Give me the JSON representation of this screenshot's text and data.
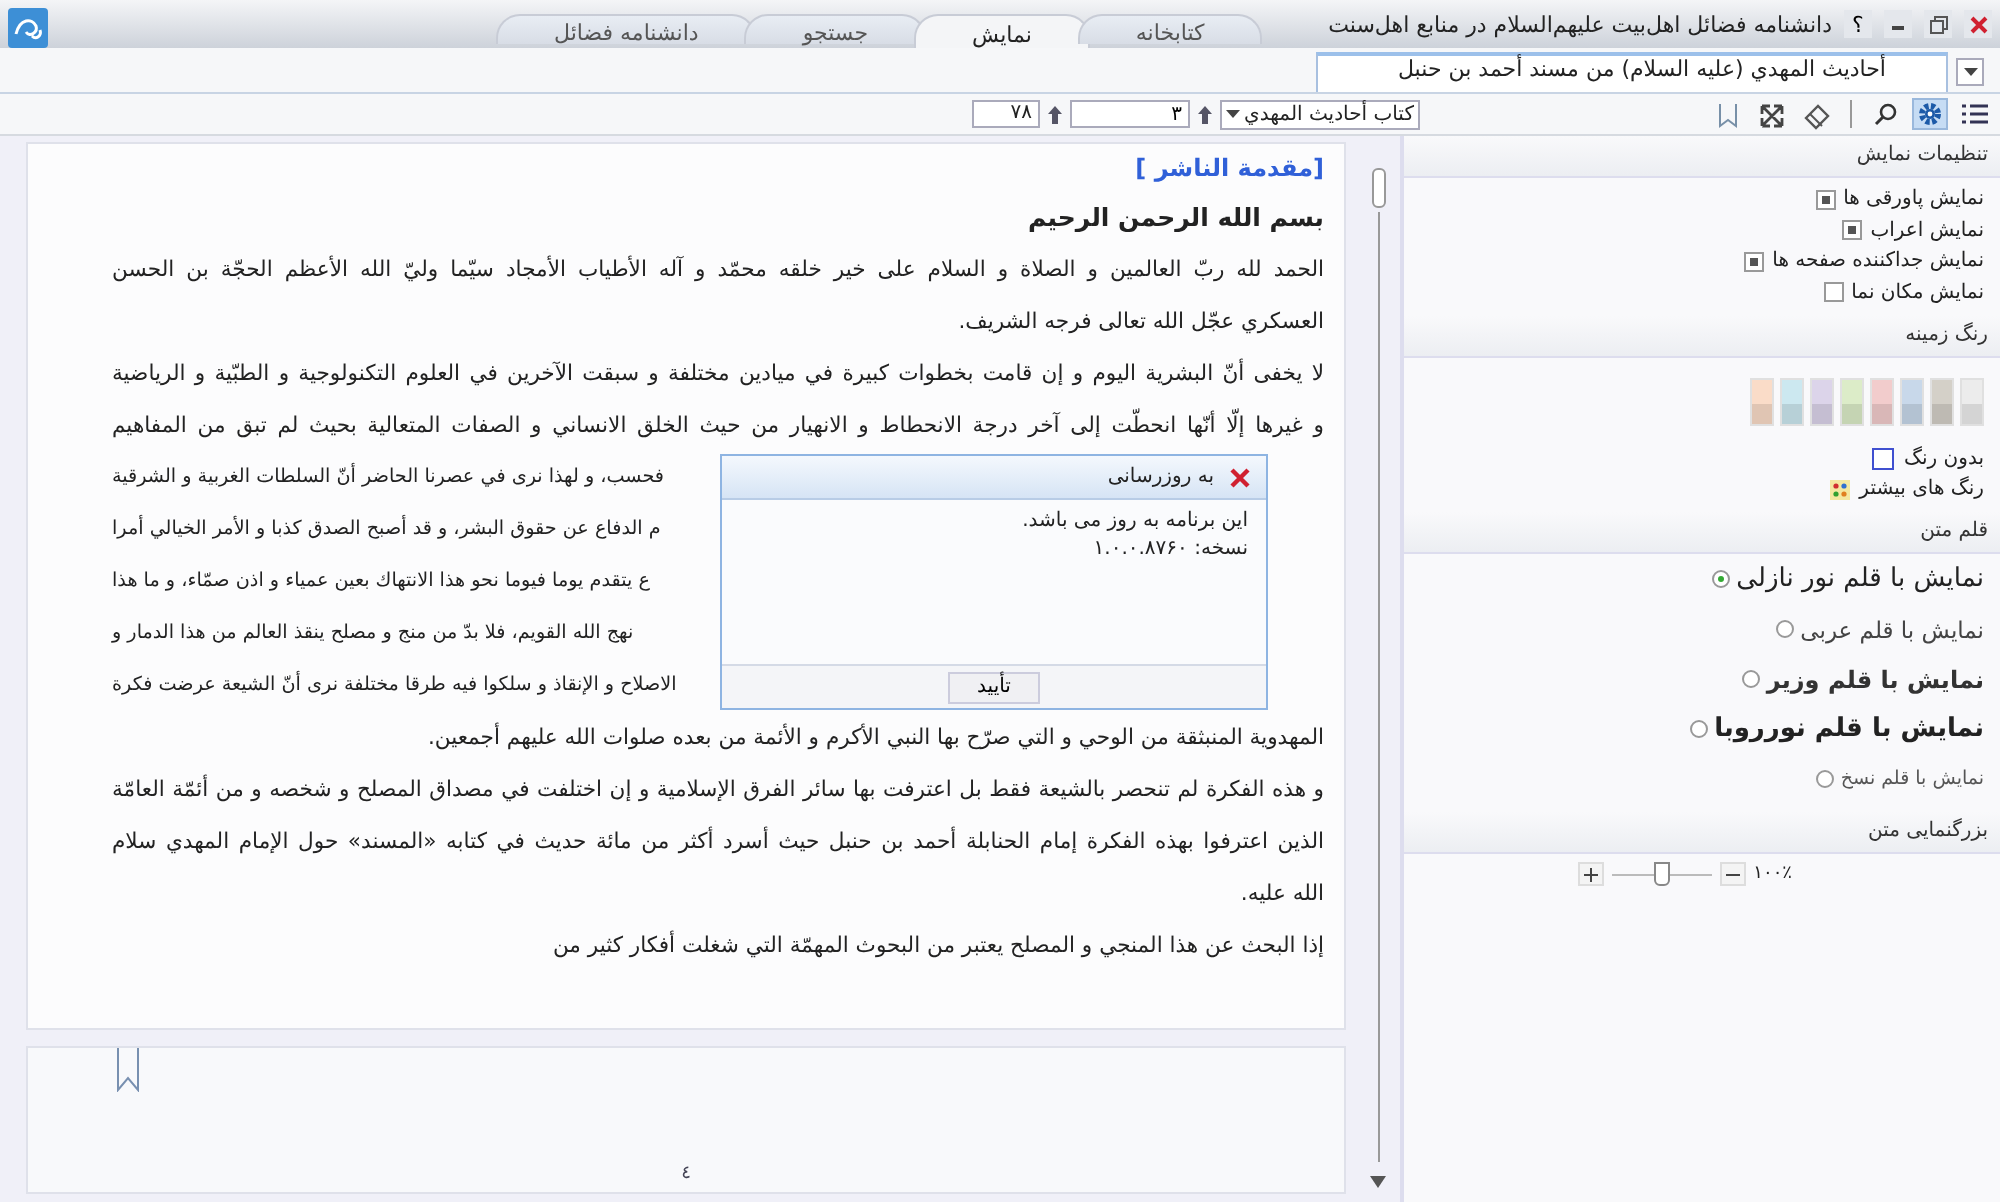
{
  "window": {
    "title": "دانشنامه فضائل اهل‌بیت علیهم‌السلام در منابع اهل‌سنت",
    "help_label": "؟"
  },
  "main_tabs": [
    {
      "label": "کتابخانه",
      "selected": false
    },
    {
      "label": "نمایش",
      "selected": true
    },
    {
      "label": "جستجو",
      "selected": false
    },
    {
      "label": "دانشنامه فضائل",
      "selected": false
    }
  ],
  "document_tab": {
    "label": "أحاديث المهدي (عليه السلام) من مسند أحمد بن حنبل"
  },
  "toolbar": {
    "tools": [
      {
        "kind": "list",
        "selected": false
      },
      {
        "kind": "settings",
        "selected": true
      },
      {
        "kind": "search",
        "selected": false
      },
      {
        "kind": "eraser",
        "selected": false
      },
      {
        "kind": "expand",
        "selected": false
      },
      {
        "kind": "bookmark",
        "selected": false
      }
    ],
    "book_select": "كتاب أحاديث المهدي",
    "page_field": "٣",
    "page_count": "٧٨"
  },
  "document": {
    "heading": "[مقدمة الناشر ]",
    "basmala": "بسم الله الرحمن الرحيم",
    "lines": [
      {
        "kind": "full",
        "text": "الحمد لله ربّ العالمين و الصلاة و السلام على خير خلقه محمّد و آله الأطياب الأمجاد سيّما وليّ الله الأعظم الحجّة بن الحسن"
      },
      {
        "kind": "last",
        "text": "العسكري عجّل الله تعالى فرجه الشريف."
      },
      {
        "kind": "full",
        "text": "لا يخفى أنّ البشرية اليوم و إن قامت بخطوات كبيرة في ميادين مختلفة و سبقت الآخرين في العلوم التكنولوجية و الطبّية و الرياضية"
      },
      {
        "kind": "full",
        "text": "و غيرها إلّا أنّها انحطّت إلى آخر درجة الانحطاط و الانهيار من حيث الخلق الانساني و الصفات المتعالية بحيث لم تبق من المفاهيم"
      },
      {
        "kind": "part",
        "text": "فحسب، و لهذا نرى في عصرنا الحاضر أنّ السلطات الغربية و الشرقية"
      },
      {
        "kind": "part",
        "text": "م الدفاع عن حقوق البشر، و قد أصبح الصدق كذبا و الأمر الخيالي أمرا"
      },
      {
        "kind": "part",
        "text": "ع يتقدم يوما فيوما نحو هذا الانتهاك بعين عمياء و اذن صمّاء، و ما هذا"
      },
      {
        "kind": "part",
        "text": "نهج الله القويم، فلا بدّ من منج و مصلح ينقذ العالم من هذا الدمار و"
      },
      {
        "kind": "part",
        "text": "الاصلاح و الإنقاذ و سلكوا فيه طرقا مختلفة نرى أنّ الشيعة عرضت فكرة"
      },
      {
        "kind": "last",
        "text": "المهدوية المنبثقة من الوحي و التي صرّح بها النبي الأكرم و الأئمة من بعده صلوات الله عليهم أجمعين."
      },
      {
        "kind": "full",
        "text": "و هذه الفكرة لم تنحصر بالشيعة فقط بل اعترفت بها سائر الفرق الإسلامية و إن اختلفت في مصداق المصلح و شخصه و من أئمّة العامّة"
      },
      {
        "kind": "full",
        "text": "الذين اعترفوا بهذه الفكرة إمام الحنابلة أحمد بن حنبل حيث أسرد أكثر من مائة حديث في كتابه «المسند» حول الإمام المهدي سلام"
      },
      {
        "kind": "last",
        "text": "الله عليه."
      },
      {
        "kind": "last",
        "text": "إذا البحث عن هذا المنجي و المصلح يعتبر من البحوث المهمّة التي شغلت أفكار كثير من"
      }
    ],
    "next_page_number": "٤"
  },
  "update_dialog": {
    "title": "به روزرسانی",
    "message": "این برنامه به روز می باشد.",
    "version": "نسخه: ۱.۰.۰.۸۷۶۰",
    "ok_button": "تأیید"
  },
  "settings_panel": {
    "sections": [
      {
        "kind": "checkboxes",
        "title": "تنظیمات نمایش",
        "items": [
          {
            "label": "نمایش پاورقی ها",
            "checked": true
          },
          {
            "label": "نمایش اعراب",
            "checked": true
          },
          {
            "label": "نمایش جداکننده صفحه ها",
            "checked": true
          },
          {
            "label": "نمایش مکان نما",
            "checked": false
          }
        ]
      },
      {
        "kind": "colors",
        "title": "رنگ زمینه",
        "swatches": [
          {
            "color": "#ececec"
          },
          {
            "color": "#d4d0c8"
          },
          {
            "color": "#c8d8ea"
          },
          {
            "color": "#f2cccc"
          },
          {
            "color": "#dcecc8"
          },
          {
            "color": "#dcd4ea"
          },
          {
            "color": "#cce8f0"
          },
          {
            "color": "#fadcc8"
          }
        ],
        "options": [
          {
            "kind": "none",
            "label": "بدون رنگ"
          },
          {
            "kind": "more",
            "label": "رنگ های بیشتر"
          }
        ]
      },
      {
        "kind": "fonts",
        "title": "قلم متن",
        "items": [
          {
            "kind": "nazli",
            "label": "نمایش با قلم نور نازلی",
            "selected": true
          },
          {
            "kind": "arabic",
            "label": "نمایش با قلم عربی",
            "selected": false
          },
          {
            "kind": "vazir",
            "label": "نمایش با قلم وزیر",
            "selected": false
          },
          {
            "kind": "nooriya",
            "label": "نمایش با قلم نورروبا",
            "selected": false
          },
          {
            "kind": "naskh",
            "label": "نمایش با قلم نسخ",
            "selected": false
          }
        ]
      },
      {
        "kind": "zoom",
        "title": "بزرگنمایی متن",
        "reading": "۱۰۰٪",
        "level": 0.5
      }
    ]
  }
}
